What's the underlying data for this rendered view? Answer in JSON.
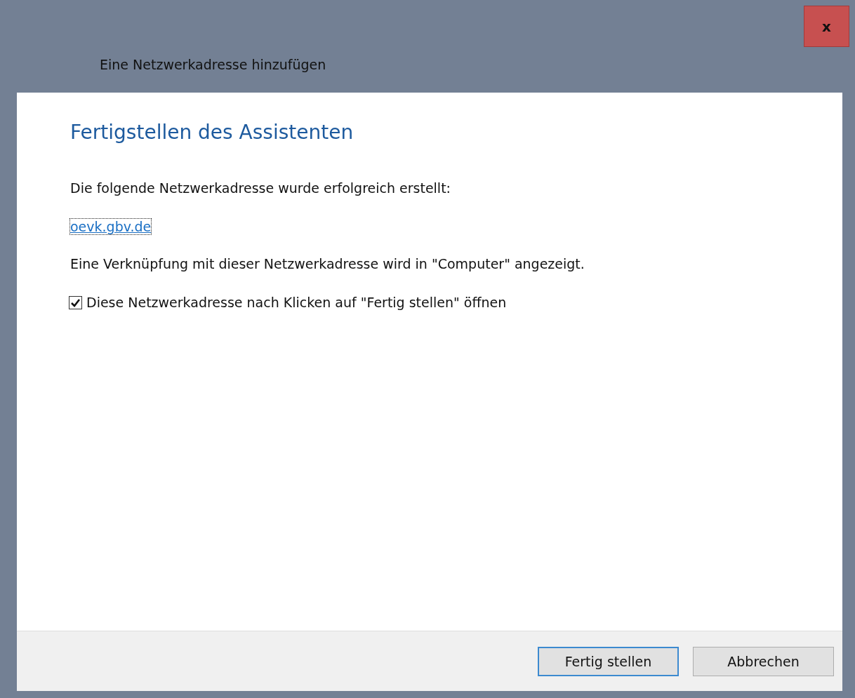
{
  "window": {
    "title": "Eine Netzwerkadresse hinzufügen",
    "close": "x"
  },
  "heading": "Fertigstellen des Assistenten",
  "message": "Die folgende Netzwerkadresse wurde erfolgreich erstellt:",
  "address_link": {
    "text": "oevk.gbv.de",
    "focused": true
  },
  "note": "Eine Verknüpfung mit dieser Netzwerkadresse wird in \"Computer\" angezeigt.",
  "open_checkbox": {
    "label": "Diese Netzwerkadresse nach Klicken auf \"Fertig stellen\" öffnen",
    "checked": true
  },
  "buttons": [
    {
      "label": "Fertig stellen",
      "default": true
    },
    {
      "label": "Abbrechen",
      "default": false
    }
  ]
}
